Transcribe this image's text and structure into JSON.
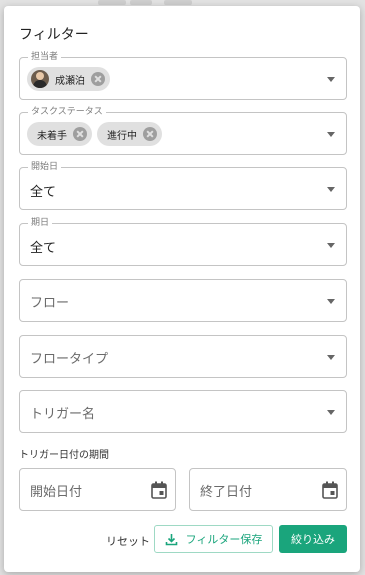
{
  "panel": {
    "title": "フィルター"
  },
  "assignee": {
    "label": "担当者",
    "chips": [
      {
        "label": "成瀬泊"
      }
    ]
  },
  "task_status": {
    "label": "タスクステータス",
    "chips": [
      {
        "label": "未着手"
      },
      {
        "label": "進行中"
      }
    ]
  },
  "start_date": {
    "label": "開始日",
    "value": "全て"
  },
  "due_date": {
    "label": "期日",
    "value": "全て"
  },
  "flow": {
    "placeholder": "フロー"
  },
  "flow_type": {
    "placeholder": "フロータイプ"
  },
  "trigger_name": {
    "placeholder": "トリガー名"
  },
  "trigger_period": {
    "label": "トリガー日付の期間",
    "start_placeholder": "開始日付",
    "end_placeholder": "終了日付"
  },
  "actions": {
    "reset_label": "リセット",
    "save_label": "フィルター保存",
    "apply_label": "絞り込み"
  },
  "colors": {
    "accent": "#1aa57c",
    "outline": "#9ed9c4",
    "chip_bg": "#e0e0e0"
  },
  "icons": {
    "dropdown": "chevron-down-icon",
    "chip_remove": "close-circle-icon",
    "calendar": "calendar-icon",
    "save": "download-icon"
  }
}
